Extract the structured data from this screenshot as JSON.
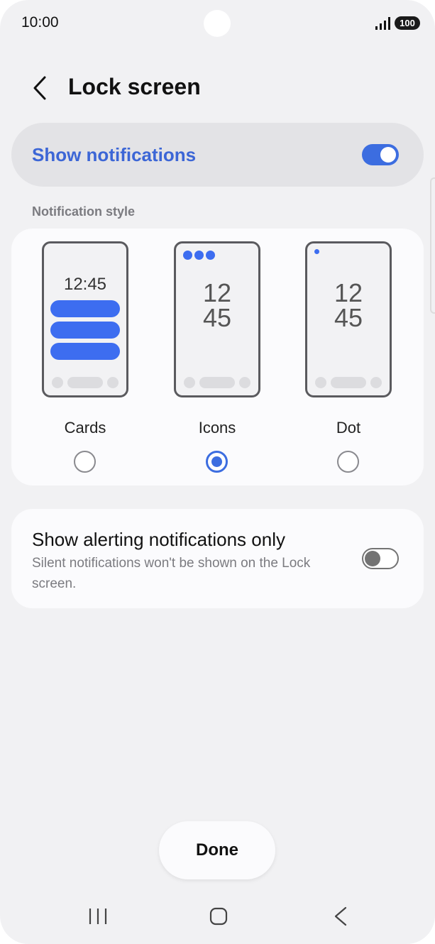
{
  "status_bar": {
    "time": "10:00",
    "battery": "100"
  },
  "header": {
    "title": "Lock screen",
    "back_icon": "chevron-left-icon"
  },
  "master": {
    "label": "Show notifications",
    "enabled": true
  },
  "notification_style": {
    "section_label": "Notification style",
    "selected": "Icons",
    "options": [
      {
        "label": "Cards",
        "preview_time": "12:45",
        "selected": false
      },
      {
        "label": "Icons",
        "preview_time": "12\n45",
        "selected": true
      },
      {
        "label": "Dot",
        "preview_time": "12\n45",
        "selected": false
      }
    ]
  },
  "alerting": {
    "title": "Show alerting notifications only",
    "description": "Silent notifications won't be shown on the Lock screen.",
    "enabled": false
  },
  "done_label": "Done",
  "colors": {
    "accent": "#3c6de0",
    "background": "#f1f1f3",
    "card": "#fbfbfd"
  },
  "nav": {
    "recents_icon": "recents-icon",
    "home_icon": "home-icon",
    "back_icon": "back-icon"
  }
}
